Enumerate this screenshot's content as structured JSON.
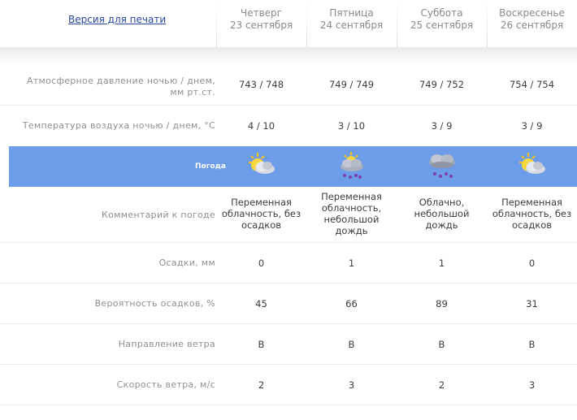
{
  "header": {
    "print_link": "Версия для печати",
    "days": [
      {
        "name": "Четверг",
        "date": "23 сентября"
      },
      {
        "name": "Пятница",
        "date": "24 сентября"
      },
      {
        "name": "Суббота",
        "date": "25 сентября"
      },
      {
        "name": "Воскресенье",
        "date": "26 сентября"
      }
    ]
  },
  "rows": {
    "pressure": {
      "label_line1": "Атмосферное давление ночью / днем,",
      "label_line2": "мм рт.ст.",
      "values": [
        "743 / 748",
        "749 / 749",
        "749 / 752",
        "754 / 754"
      ]
    },
    "temperature": {
      "label": "Температура воздуха ночью / днем, °C",
      "values": [
        "4 / 10",
        "3 / 10",
        "3 / 9",
        "3 / 9"
      ]
    },
    "weather": {
      "label": "Погода",
      "icons": [
        "sun-cloud-icon",
        "sun-cloud-rain-icon",
        "cloud-rain-icon",
        "sun-cloud-icon"
      ]
    },
    "comment": {
      "label": "Комментарий к погоде",
      "values": [
        [
          "Переменная",
          "облачность, без",
          "осадков"
        ],
        [
          "Переменная",
          "облачность,",
          "небольшой",
          "дождь"
        ],
        [
          "Облачно,",
          "небольшой",
          "дождь"
        ],
        [
          "Переменная",
          "облачность, без",
          "осадков"
        ]
      ]
    },
    "precip": {
      "label": "Осадки, мм",
      "values": [
        "0",
        "1",
        "1",
        "0"
      ]
    },
    "probability": {
      "label": "Вероятность осадков, %",
      "values": [
        "45",
        "66",
        "89",
        "31"
      ]
    },
    "wind_dir": {
      "label": "Направление ветра",
      "values": [
        "В",
        "В",
        "В",
        "В"
      ]
    },
    "wind_speed": {
      "label": "Скорость ветра, м/с",
      "values": [
        "2",
        "3",
        "2",
        "3"
      ]
    }
  },
  "colors": {
    "weather_band": "#6d9ce8",
    "link": "#27479a"
  }
}
